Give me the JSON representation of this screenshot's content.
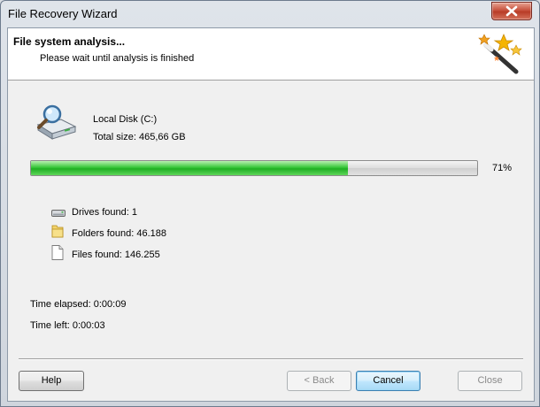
{
  "window": {
    "title": "File Recovery Wizard"
  },
  "header": {
    "title": "File system analysis...",
    "subtitle": "Please wait until analysis is finished",
    "icon": "magic-wand-icon"
  },
  "disk": {
    "name": "Local Disk (C:)",
    "total_size": "Total size: 465,66 GB",
    "icon": "disk-search-icon"
  },
  "progress": {
    "percent": 71,
    "label": "71%"
  },
  "stats": [
    {
      "icon": "drive-icon",
      "label": "Drives found: 1"
    },
    {
      "icon": "folder-icon",
      "label": "Folders found: 46.188"
    },
    {
      "icon": "file-icon",
      "label": "Files found: 146.255"
    }
  ],
  "time": {
    "elapsed": "Time elapsed: 0:00:09",
    "left": "Time left: 0:00:03"
  },
  "buttons": {
    "help": "Help",
    "back": "< Back",
    "cancel": "Cancel",
    "close": "Close"
  },
  "colors": {
    "progress_fill": "#1fae23",
    "close_button": "#c7523e"
  }
}
